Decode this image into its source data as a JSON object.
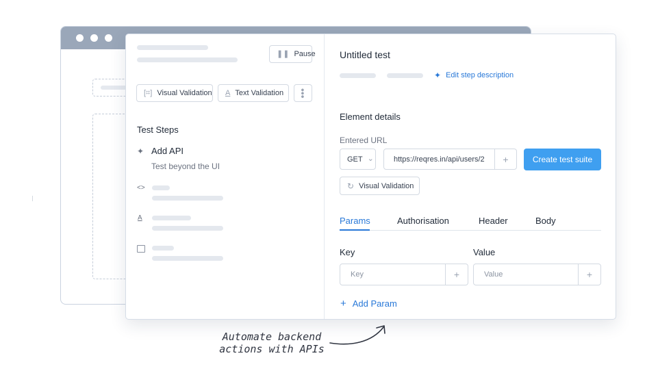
{
  "left": {
    "pause_label": "Pause",
    "visual_validation_label": "Visual Validation",
    "text_validation_label": "Text Validation",
    "steps_title": "Test Steps",
    "step_add_api_title": "Add API",
    "step_add_api_subtitle": "Test beyond the UI"
  },
  "right": {
    "test_title": "Untitled test",
    "edit_description_label": "Edit step description",
    "element_details_title": "Element details",
    "entered_url_label": "Entered URL",
    "method_value": "GET",
    "url_value": "https://reqres.in/api/users/2",
    "create_suite_label": "Create test suite",
    "visual_validation_label": "Visual Validation",
    "tabs": [
      "Params",
      "Authorisation",
      "Header",
      "Body"
    ],
    "active_tab": "Params",
    "key_label": "Key",
    "value_label": "Value",
    "key_placeholder": "Key",
    "value_placeholder": "Value",
    "add_param_label": "Add Param"
  },
  "annotation": {
    "line1": "Automate backend",
    "line2": "actions with APIs"
  },
  "colors": {
    "accent": "#2878d8",
    "primary_button": "#3f9ff0",
    "titlebar": "#9aa7b9"
  }
}
